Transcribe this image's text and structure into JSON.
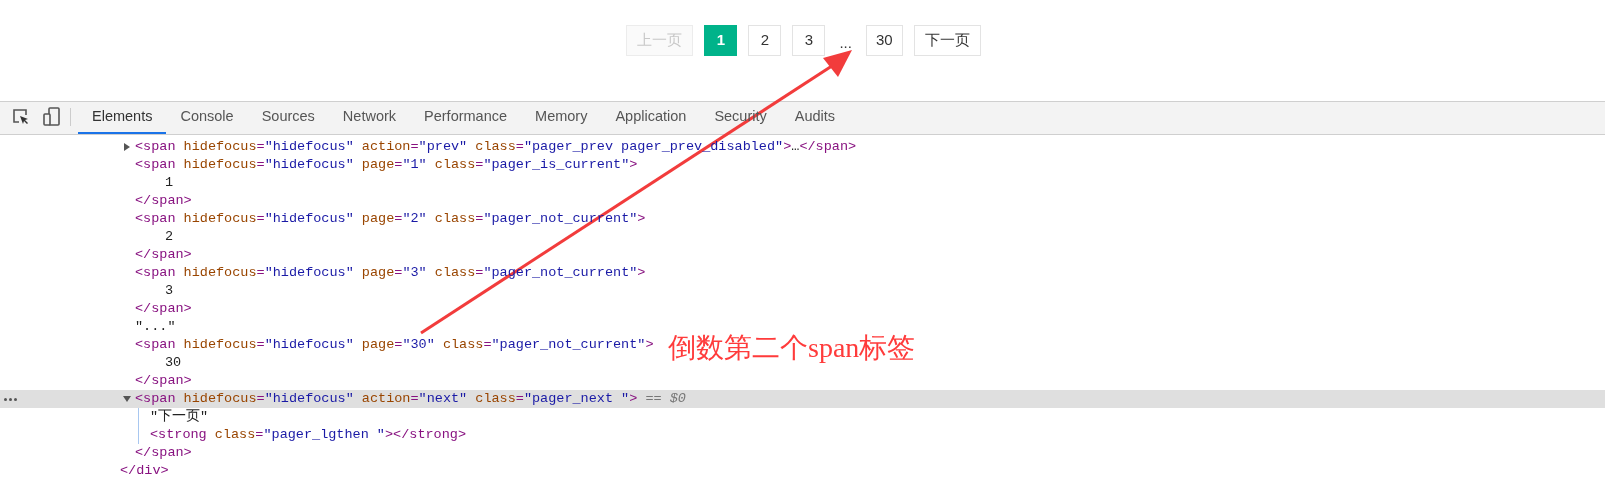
{
  "pager": [
    {
      "kind": "prev",
      "label": "上一页",
      "selected": false,
      "disabled": true
    },
    {
      "kind": "page",
      "label": "1",
      "selected": true,
      "disabled": false
    },
    {
      "kind": "page",
      "label": "2",
      "selected": false,
      "disabled": false
    },
    {
      "kind": "page",
      "label": "3",
      "selected": false,
      "disabled": false
    },
    {
      "kind": "ellipsis",
      "label": "..."
    },
    {
      "kind": "page",
      "label": "30",
      "selected": false,
      "disabled": false
    },
    {
      "kind": "next",
      "label": "下一页",
      "selected": false,
      "disabled": false
    }
  ],
  "devtools": {
    "tabs": [
      {
        "label": "Elements",
        "selected": true
      },
      {
        "label": "Console",
        "selected": false
      },
      {
        "label": "Sources",
        "selected": false
      },
      {
        "label": "Network",
        "selected": false
      },
      {
        "label": "Performance",
        "selected": false
      },
      {
        "label": "Memory",
        "selected": false
      },
      {
        "label": "Application",
        "selected": false
      },
      {
        "label": "Security",
        "selected": false
      },
      {
        "label": "Audits",
        "selected": false
      }
    ],
    "tree": {
      "children": [
        {
          "kind": "collapsed",
          "selected": false,
          "tokens": [
            {
              "kind": "tag",
              "text": "<span"
            },
            {
              "kind": "attr",
              "text": "hidefocus"
            },
            {
              "kind": "eq",
              "text": "="
            },
            {
              "kind": "val",
              "text": "\"hidefocus\""
            },
            {
              "kind": "attr",
              "text": "action"
            },
            {
              "kind": "eq",
              "text": "="
            },
            {
              "kind": "val",
              "text": "\"prev\""
            },
            {
              "kind": "attr",
              "text": "class"
            },
            {
              "kind": "eq",
              "text": "="
            },
            {
              "kind": "val",
              "text": "\"pager_prev pager_prev_disabled\""
            },
            {
              "kind": "tag",
              "text": ">"
            },
            {
              "kind": "ellipsis",
              "text": "…"
            },
            {
              "kind": "tag",
              "text": "</span>"
            }
          ]
        },
        {
          "kind": "open",
          "selected": false,
          "tokens": [
            {
              "kind": "tag",
              "text": "<span"
            },
            {
              "kind": "attr",
              "text": "hidefocus"
            },
            {
              "kind": "eq",
              "text": "="
            },
            {
              "kind": "val",
              "text": "\"hidefocus\""
            },
            {
              "kind": "attr",
              "text": "page"
            },
            {
              "kind": "eq",
              "text": "="
            },
            {
              "kind": "val",
              "text": "\"1\""
            },
            {
              "kind": "attr",
              "text": "class"
            },
            {
              "kind": "eq",
              "text": "="
            },
            {
              "kind": "val",
              "text": "\"pager_is_current\""
            },
            {
              "kind": "tag",
              "text": ">"
            }
          ],
          "children": [
            {
              "kind": "leaf",
              "selected": false,
              "tokens": [
                {
                  "kind": "text",
                  "text": "1"
                }
              ]
            }
          ],
          "closing": [
            {
              "kind": "tag",
              "text": "</span>"
            }
          ]
        },
        {
          "kind": "open",
          "selected": false,
          "tokens": [
            {
              "kind": "tag",
              "text": "<span"
            },
            {
              "kind": "attr",
              "text": "hidefocus"
            },
            {
              "kind": "eq",
              "text": "="
            },
            {
              "kind": "val",
              "text": "\"hidefocus\""
            },
            {
              "kind": "attr",
              "text": "page"
            },
            {
              "kind": "eq",
              "text": "="
            },
            {
              "kind": "val",
              "text": "\"2\""
            },
            {
              "kind": "attr",
              "text": "class"
            },
            {
              "kind": "eq",
              "text": "="
            },
            {
              "kind": "val",
              "text": "\"pager_not_current\""
            },
            {
              "kind": "tag",
              "text": ">"
            }
          ],
          "children": [
            {
              "kind": "leaf",
              "selected": false,
              "tokens": [
                {
                  "kind": "text",
                  "text": "2"
                }
              ]
            }
          ],
          "closing": [
            {
              "kind": "tag",
              "text": "</span>"
            }
          ]
        },
        {
          "kind": "open",
          "selected": false,
          "tokens": [
            {
              "kind": "tag",
              "text": "<span"
            },
            {
              "kind": "attr",
              "text": "hidefocus"
            },
            {
              "kind": "eq",
              "text": "="
            },
            {
              "kind": "val",
              "text": "\"hidefocus\""
            },
            {
              "kind": "attr",
              "text": "page"
            },
            {
              "kind": "eq",
              "text": "="
            },
            {
              "kind": "val",
              "text": "\"3\""
            },
            {
              "kind": "attr",
              "text": "class"
            },
            {
              "kind": "eq",
              "text": "="
            },
            {
              "kind": "val",
              "text": "\"pager_not_current\""
            },
            {
              "kind": "tag",
              "text": ">"
            }
          ],
          "children": [
            {
              "kind": "leaf",
              "selected": false,
              "tokens": [
                {
                  "kind": "text",
                  "text": "3"
                }
              ]
            }
          ],
          "closing": [
            {
              "kind": "tag",
              "text": "</span>"
            }
          ]
        },
        {
          "kind": "leaf",
          "selected": false,
          "tokens": [
            {
              "kind": "text",
              "text": "\"...\""
            }
          ]
        },
        {
          "kind": "open",
          "selected": false,
          "tokens": [
            {
              "kind": "tag",
              "text": "<span"
            },
            {
              "kind": "attr",
              "text": "hidefocus"
            },
            {
              "kind": "eq",
              "text": "="
            },
            {
              "kind": "val",
              "text": "\"hidefocus\""
            },
            {
              "kind": "attr",
              "text": "page"
            },
            {
              "kind": "eq",
              "text": "="
            },
            {
              "kind": "val",
              "text": "\"30\""
            },
            {
              "kind": "attr",
              "text": "class"
            },
            {
              "kind": "eq",
              "text": "="
            },
            {
              "kind": "val",
              "text": "\"pager_not_current\""
            },
            {
              "kind": "tag",
              "text": ">"
            }
          ],
          "children": [
            {
              "kind": "leaf",
              "selected": false,
              "tokens": [
                {
                  "kind": "text",
                  "text": "30"
                }
              ]
            }
          ],
          "closing": [
            {
              "kind": "tag",
              "text": "</span>"
            }
          ]
        },
        {
          "kind": "expanded",
          "selected": true,
          "ref": "== $0",
          "tokens": [
            {
              "kind": "tag",
              "text": "<span"
            },
            {
              "kind": "attr",
              "text": "hidefocus"
            },
            {
              "kind": "eq",
              "text": "="
            },
            {
              "kind": "val",
              "text": "\"hidefocus\""
            },
            {
              "kind": "attr",
              "text": "action"
            },
            {
              "kind": "eq",
              "text": "="
            },
            {
              "kind": "val",
              "text": "\"next\""
            },
            {
              "kind": "attr",
              "text": "class"
            },
            {
              "kind": "eq",
              "text": "="
            },
            {
              "kind": "val",
              "text": "\"pager_next \""
            },
            {
              "kind": "tag",
              "text": ">"
            }
          ],
          "children": [
            {
              "kind": "leaf",
              "selected": false,
              "tokens": [
                {
                  "kind": "text",
                  "text": "\"下一页\""
                }
              ]
            },
            {
              "kind": "leaf",
              "selected": false,
              "tokens": [
                {
                  "kind": "tag",
                  "text": "<strong"
                },
                {
                  "kind": "attr",
                  "text": "class"
                },
                {
                  "kind": "eq",
                  "text": "="
                },
                {
                  "kind": "val",
                  "text": "\"pager_lgthen \""
                },
                {
                  "kind": "tag",
                  "text": ">"
                },
                {
                  "kind": "tag",
                  "text": "</strong>"
                }
              ]
            }
          ],
          "closing": [
            {
              "kind": "tag",
              "text": "</span>"
            }
          ]
        }
      ],
      "closing": [
        {
          "kind": "tag",
          "text": "</div>"
        }
      ]
    }
  },
  "annotation": {
    "text": "倒数第二个span标签"
  }
}
